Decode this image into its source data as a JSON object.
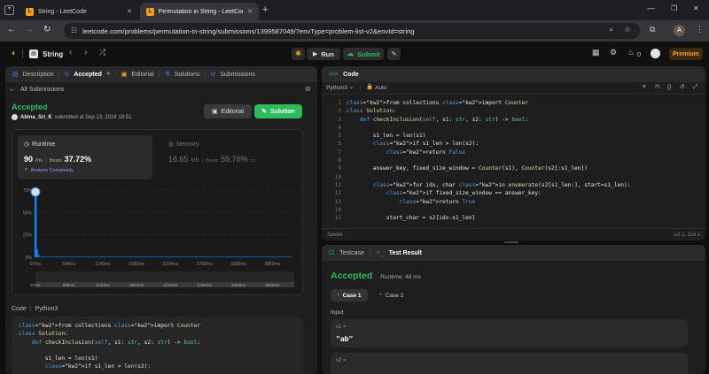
{
  "browser": {
    "tabs": [
      {
        "title": "String - LeetCode",
        "active": false
      },
      {
        "title": "Permutation in String - LeetCode",
        "active": true
      }
    ],
    "new_tab_icon": "plus-icon",
    "url": "leetcode.com/problems/permutation-in-string/submissions/1399587049/?envType=problem-list-v2&envId=string"
  },
  "nav": {
    "problem_list": "String",
    "run_label": "Run",
    "submit_label": "Submit",
    "fire_count": "0",
    "premium_label": "Premium"
  },
  "left": {
    "tabs": [
      "Description",
      "Accepted",
      "Editorial",
      "Solutions",
      "Submissions"
    ],
    "back_label": "All Submissions",
    "status": "Accepted",
    "user": "Abina_Sri_K",
    "submitted": "submitted at Sep 23, 2024 18:51",
    "editorial_btn": "Editorial",
    "solution_btn": "Solution",
    "runtime": {
      "label": "Runtime",
      "value": "90",
      "unit": "ms",
      "beats_label": "Beats",
      "beats": "37.72%",
      "analyze": "Analyze Complexity"
    },
    "memory": {
      "label": "Memory",
      "value": "16.65",
      "unit": "MB",
      "beats_label": "Beats",
      "beats": "59.76%"
    },
    "code_label": "Code",
    "code_lang": "Python3",
    "code_lines": [
      "from collections import Counter",
      "class Solution:",
      "    def checkInclusion(self, s1: str, s2: str) -> bool:",
      "",
      "        s1_len = len(s1)",
      "        if s1_len > len(s2):"
    ]
  },
  "chart_data": {
    "type": "bar",
    "y_ticks": [
      "75%",
      "50%",
      "25%",
      "0%"
    ],
    "ylim": [
      0,
      75
    ],
    "x_ticks": [
      "67ms",
      "598ms",
      "1140ms",
      "1682ms",
      "2224ms",
      "2766ms",
      "3308ms",
      "3850ms"
    ],
    "x_range": [
      67,
      4200
    ],
    "bars": [
      {
        "x": 67,
        "value": 70,
        "highlight": true
      },
      {
        "x": 90,
        "value": 9
      },
      {
        "x": 112,
        "value": 3
      }
    ],
    "baseline_percent": 0.8,
    "minimap_ticks": [
      "57ms",
      "598ms",
      "1140ms",
      "1682ms",
      "2224ms",
      "2766ms",
      "3308ms",
      "3850ms"
    ]
  },
  "editor": {
    "title": "Code",
    "lang": "Python3",
    "mode": "Auto",
    "saved": "Saved",
    "cursor": "Ln 1, Col 1",
    "lines": [
      "from collections import Counter",
      "class Solution:",
      "    def checkInclusion(self, s1: str, s2: str) -> bool:",
      "",
      "        s1_len = len(s1)",
      "        if s1_len > len(s2):",
      "            return False",
      "",
      "        answer_key, fixed_size_window = Counter(s1), Counter(s2[:s1_len])",
      "",
      "        for idx, char in enumerate(s2[s1_len:], start=s1_len):",
      "            if fixed_size_window == answer_key:",
      "                return True",
      "",
      "            start_char = s2[idx-s1_len]"
    ]
  },
  "result": {
    "tab_testcase": "Testcase",
    "tab_result": "Test Result",
    "status": "Accepted",
    "runtime": "Runtime: 48 ms",
    "case1": "Case 1",
    "case2": "Case 2",
    "input_label": "Input",
    "s1_label": "s1 =",
    "s1_value": "\"ab\"",
    "s2_label": "s2 ="
  },
  "colors": {
    "accepted": "#2cbb5d",
    "accent": "#ffa116",
    "runtime_bar": "#0a84ff"
  }
}
